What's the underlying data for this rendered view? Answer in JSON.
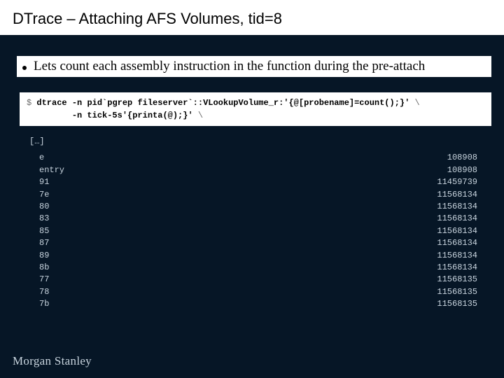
{
  "title": "DTrace – Attaching AFS Volumes, tid=8",
  "bullet": "Lets count each assembly instruction in the function during the pre-attach",
  "cmd": {
    "prompt": "$ ",
    "dtrace": "dtrace",
    "flag1": "-n",
    "arg1": "pid`pgrep fileserver`::VLookupVolume_r:'{@[probename]=count();}'",
    "flag2": "-n",
    "arg2": "tick-5s'{printa(@);}'"
  },
  "ellipsis": "[…]",
  "rows": [
    {
      "lhs": "e",
      "rhs": "108908"
    },
    {
      "lhs": "entry",
      "rhs": "108908"
    },
    {
      "lhs": "91",
      "rhs": "11459739"
    },
    {
      "lhs": "7e",
      "rhs": "11568134"
    },
    {
      "lhs": "80",
      "rhs": "11568134"
    },
    {
      "lhs": "83",
      "rhs": "11568134"
    },
    {
      "lhs": "85",
      "rhs": "11568134"
    },
    {
      "lhs": "87",
      "rhs": "11568134"
    },
    {
      "lhs": "89",
      "rhs": "11568134"
    },
    {
      "lhs": "8b",
      "rhs": "11568134"
    },
    {
      "lhs": "77",
      "rhs": "11568135"
    },
    {
      "lhs": "78",
      "rhs": "11568135"
    },
    {
      "lhs": "7b",
      "rhs": "11568135"
    }
  ],
  "logo": {
    "first": "Morgan",
    "second": "Stanley"
  }
}
